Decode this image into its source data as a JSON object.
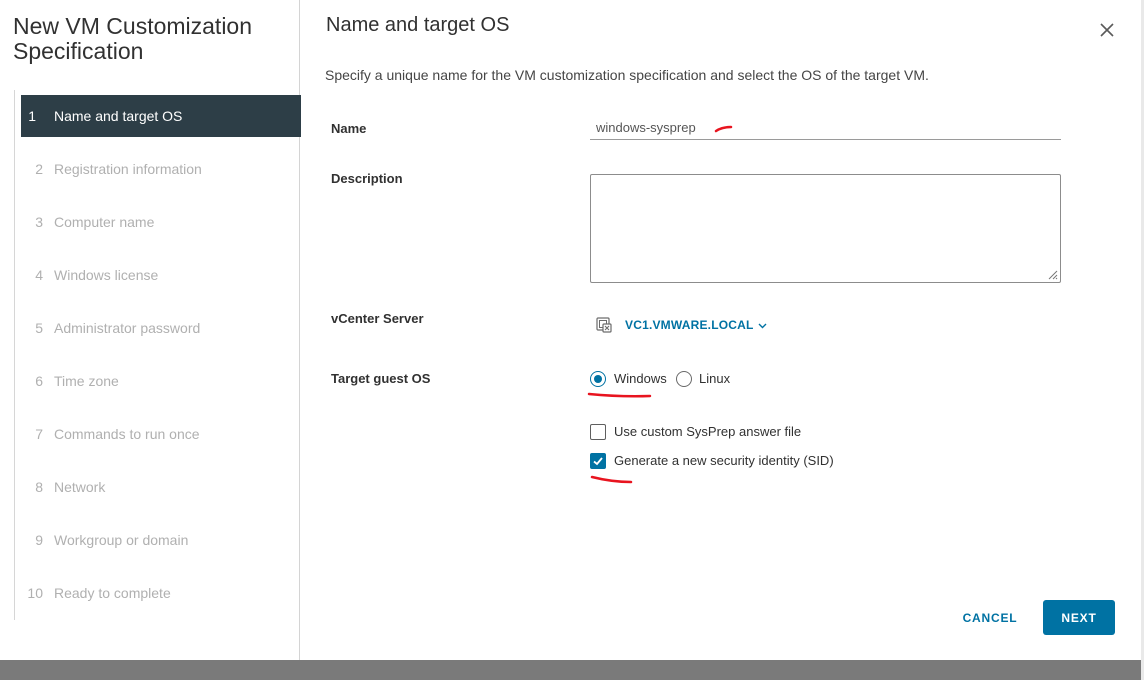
{
  "wizard": {
    "title": "New VM Customization Specification",
    "steps": [
      {
        "num": "1",
        "label": "Name and target OS",
        "active": true
      },
      {
        "num": "2",
        "label": "Registration information"
      },
      {
        "num": "3",
        "label": "Computer name"
      },
      {
        "num": "4",
        "label": "Windows license"
      },
      {
        "num": "5",
        "label": "Administrator password"
      },
      {
        "num": "6",
        "label": "Time zone"
      },
      {
        "num": "7",
        "label": "Commands to run once"
      },
      {
        "num": "8",
        "label": "Network"
      },
      {
        "num": "9",
        "label": "Workgroup or domain"
      },
      {
        "num": "10",
        "label": "Ready to complete"
      }
    ]
  },
  "page": {
    "title": "Name and target OS",
    "intro": "Specify a unique name for the VM customization specification and select the OS of the target VM.",
    "close_icon": "close-icon"
  },
  "form": {
    "name_label": "Name",
    "name_value": "windows-sysprep",
    "description_label": "Description",
    "description_value": "",
    "vcenter_label": "vCenter Server",
    "vcenter_value": "VC1.VMWARE.LOCAL",
    "vcenter_icon": "vcenter-server-icon",
    "guest_os_label": "Target guest OS",
    "guest_os_options": [
      {
        "label": "Windows",
        "selected": true
      },
      {
        "label": "Linux",
        "selected": false
      }
    ],
    "use_sysprep_label": "Use custom SysPrep answer file",
    "use_sysprep_checked": false,
    "generate_sid_label": "Generate a new security identity (SID)",
    "generate_sid_checked": true
  },
  "footer": {
    "cancel_label": "CANCEL",
    "next_label": "NEXT"
  },
  "colors": {
    "accent": "#0072a3",
    "active_step_bg": "#2d3e47",
    "annotation": "#e8141f"
  }
}
